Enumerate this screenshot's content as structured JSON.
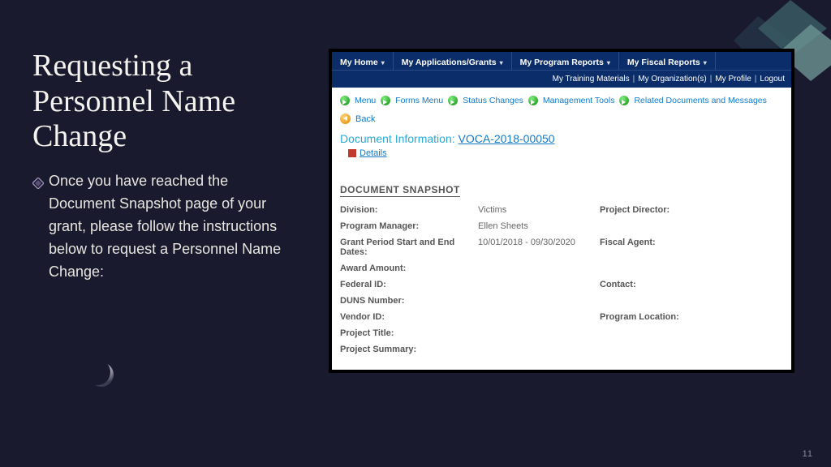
{
  "slide": {
    "title": "Requesting a Personnel Name Change",
    "bullet": "Once you have reached the Document Snapshot page of your grant, please follow the instructions below to request a Personnel Name Change:",
    "page_number": "11"
  },
  "app": {
    "tabs": [
      "My Home",
      "My Applications/Grants",
      "My Program Reports",
      "My Fiscal Reports"
    ],
    "user_links": [
      "My Training Materials",
      "My Organization(s)",
      "My Profile",
      "Logout"
    ],
    "crumbs": [
      "Menu",
      "Forms Menu",
      "Status Changes",
      "Management Tools",
      "Related Documents and Messages"
    ],
    "back_label": "Back",
    "doc_info_label": "Document Information:",
    "doc_number": "VOCA-2018-00050",
    "details_label": "Details",
    "snapshot_title": "DOCUMENT SNAPSHOT",
    "fields": {
      "division_label": "Division:",
      "division_value": "Victims",
      "project_director_label": "Project Director:",
      "program_manager_label": "Program Manager:",
      "program_manager_value": "Ellen Sheets",
      "grant_period_label": "Grant Period Start and End Dates:",
      "grant_period_value": "10/01/2018 - 09/30/2020",
      "fiscal_agent_label": "Fiscal Agent:",
      "award_amount_label": "Award Amount:",
      "federal_id_label": "Federal ID:",
      "contact_label": "Contact:",
      "duns_label": "DUNS Number:",
      "vendor_id_label": "Vendor ID:",
      "program_location_label": "Program Location:",
      "project_title_label": "Project Title:",
      "project_summary_label": "Project Summary:"
    }
  }
}
